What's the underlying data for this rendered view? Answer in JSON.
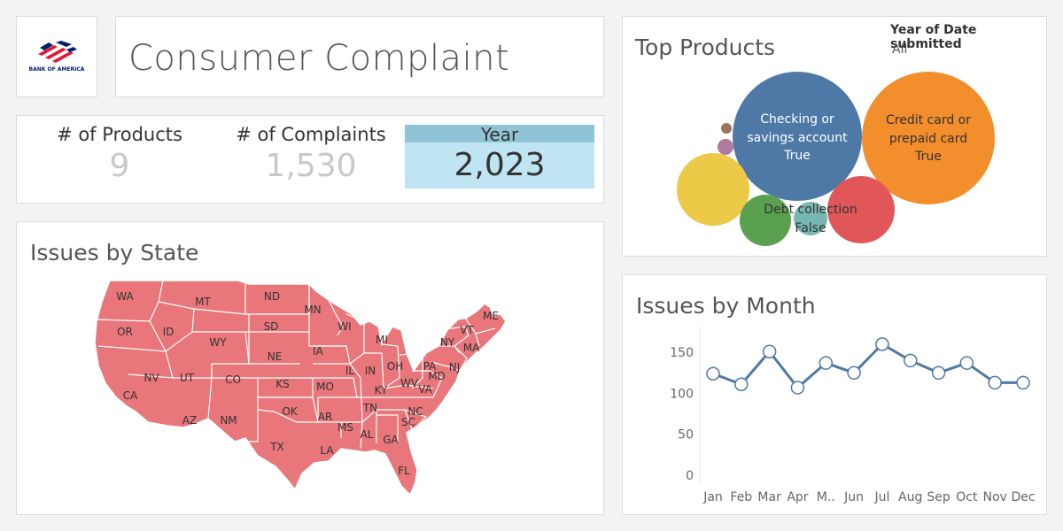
{
  "logo": {
    "text": "BANK OF AMERICA",
    "colors": {
      "red": "#e31837",
      "blue": "#012169"
    }
  },
  "dashboard_title": "Consumer Complaint",
  "kpis": {
    "products_label": "# of Products",
    "products_value": "9",
    "complaints_label": "# of Complaints",
    "complaints_value": "1,530",
    "year_label": "Year",
    "year_value": "2,023"
  },
  "map_panel": {
    "title": "Issues by State",
    "fill_color": "#e8767a",
    "states": [
      "WA",
      "OR",
      "CA",
      "NV",
      "ID",
      "MT",
      "WY",
      "UT",
      "AZ",
      "CO",
      "NM",
      "ND",
      "SD",
      "NE",
      "KS",
      "OK",
      "TX",
      "MN",
      "IA",
      "MO",
      "AR",
      "LA",
      "WI",
      "IL",
      "MI",
      "IN",
      "OH",
      "KY",
      "TN",
      "MS",
      "AL",
      "GA",
      "FL",
      "SC",
      "NC",
      "VA",
      "WV",
      "PA",
      "NY",
      "VT",
      "ME",
      "MA",
      "NJ",
      "MD"
    ]
  },
  "products_panel": {
    "title": "Top Products",
    "filter_label": "Year of Date submitted",
    "filter_value": "All",
    "bubble_labels": {
      "checking_line1": "Checking or",
      "checking_line2": "savings account",
      "checking_line3": "True",
      "credit_line1": "Credit card or",
      "credit_line2": "prepaid card",
      "credit_line3": "True",
      "debt_line1": "Debt collection",
      "debt_line2": "False"
    },
    "colors": [
      "#4e79a7",
      "#f28e2b",
      "#e15759",
      "#edc948",
      "#59a14f",
      "#76b7b2",
      "#b07aa1",
      "#9c755f"
    ]
  },
  "month_panel": {
    "title": "Issues by Month"
  },
  "chart_data": {
    "type": "line",
    "categories": [
      "Jan",
      "Feb",
      "Mar",
      "Apr",
      "M..",
      "Jun",
      "Jul",
      "Aug",
      "Sep",
      "Oct",
      "Nov",
      "Dec"
    ],
    "values": [
      124,
      111,
      151,
      107,
      137,
      125,
      160,
      140,
      125,
      137,
      113,
      113
    ],
    "ylim": [
      0,
      175
    ],
    "yticks": [
      "0",
      "50",
      "100",
      "150"
    ],
    "title": "Issues by Month",
    "xlabel": "",
    "ylabel": "",
    "line_color": "#4e79a7"
  }
}
